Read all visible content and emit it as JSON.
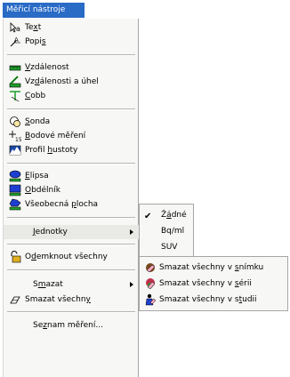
{
  "header": {
    "title": "Měřicí nástroje"
  },
  "menu": {
    "text": {
      "pre": "Te",
      "u": "x",
      "post": "t"
    },
    "popis": {
      "pre": "Popi",
      "u": "s",
      "post": ""
    },
    "vzdalenost": {
      "pre": "",
      "u": "V",
      "post": "zdálenost"
    },
    "vzdalenost_uhel": {
      "pre": "Vz",
      "u": "d",
      "post": "álenosti a úhel"
    },
    "cobb": {
      "pre": "",
      "u": "C",
      "post": "obb"
    },
    "sonda": {
      "pre": "",
      "u": "S",
      "post": "onda"
    },
    "bodove": {
      "pre": "",
      "u": "B",
      "post": "odové měření"
    },
    "profil": {
      "pre": "Profil ",
      "u": "h",
      "post": "ustoty"
    },
    "elipsa": {
      "pre": "",
      "u": "E",
      "post": "lipsa"
    },
    "obdelnik": {
      "pre": "",
      "u": "O",
      "post": "bdélník"
    },
    "vseobecna": {
      "pre": "Všeobecná ",
      "u": "p",
      "post": "locha"
    },
    "jednotky": {
      "pre": "",
      "u": "J",
      "post": "ednotky"
    },
    "odemknout": {
      "pre": "O",
      "u": "d",
      "post": "emknout všechny"
    },
    "smazat": {
      "pre": "S",
      "u": "m",
      "post": "azat"
    },
    "smazat_vsechny": {
      "pre": "Smazat všechn",
      "u": "y",
      "post": ""
    },
    "seznam": {
      "pre": "Se",
      "u": "z",
      "post": "nam měření..."
    }
  },
  "units_submenu": {
    "zadne": {
      "pre": "Ž",
      "u": "á",
      "post": "dné"
    },
    "bqml": "Bq/ml",
    "suv": "SUV"
  },
  "delete_submenu": {
    "snimku": {
      "pre": "Smazat všechny v ",
      "u": "s",
      "post": "nímku"
    },
    "serii": {
      "pre": "Smazat všechny v ",
      "u": "s",
      "post": "érii"
    },
    "studii": {
      "pre": "Smazat všechny v s",
      "u": "t",
      "post": "udii"
    }
  },
  "colors": {
    "header_bg": "#2a6bc6",
    "menu_bg": "#f7f7f5",
    "border": "#a6a6a6"
  }
}
